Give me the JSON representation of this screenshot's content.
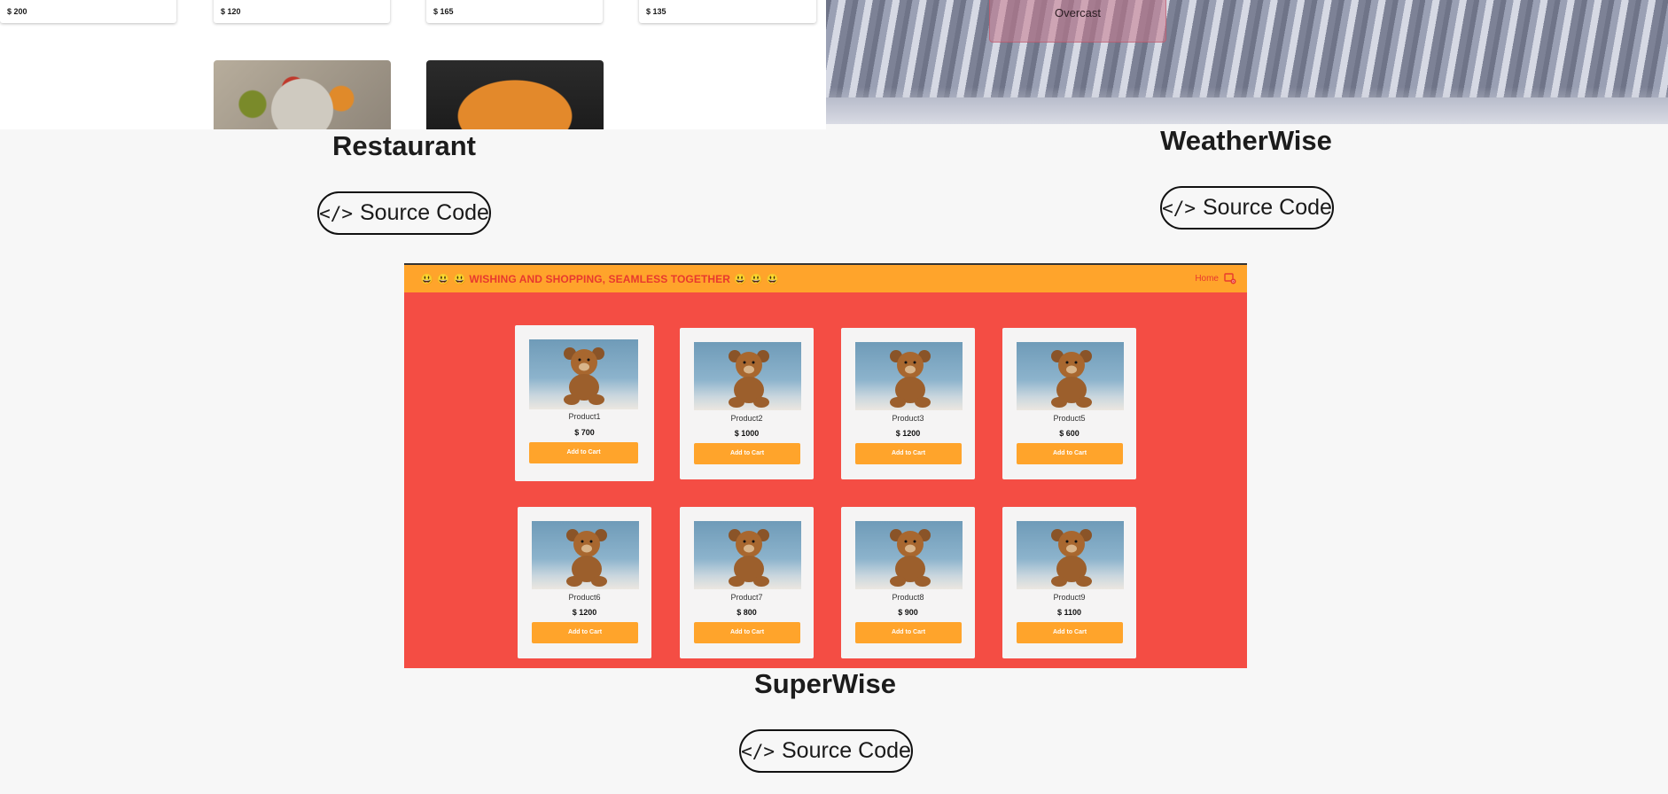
{
  "restaurant_preview": {
    "prices": [
      "$ 200",
      "$ 120",
      "$ 165",
      "$ 135"
    ]
  },
  "weather_preview": {
    "condition": "Overcast"
  },
  "projects": {
    "restaurant": {
      "title": "Restaurant",
      "button": "Source Code"
    },
    "weatherwise": {
      "title": "WeatherWise",
      "button": "Source Code"
    },
    "superwise": {
      "title": "SuperWise",
      "button": "Source Code"
    }
  },
  "superwise_preview": {
    "tagline": "😃 😃 😃 WISHING AND SHOPPING, SEAMLESS TOGETHER 😃 😃 😃",
    "nav_home": "Home",
    "cart_count": "0",
    "add_to_cart_label": "Add to Cart",
    "products": [
      {
        "name": "Product1",
        "price": "$ 700"
      },
      {
        "name": "Product2",
        "price": "$ 1000"
      },
      {
        "name": "Product3",
        "price": "$ 1200"
      },
      {
        "name": "Product5",
        "price": "$ 600"
      },
      {
        "name": "Product6",
        "price": "$ 1200"
      },
      {
        "name": "Product7",
        "price": "$ 800"
      },
      {
        "name": "Product8",
        "price": "$ 900"
      },
      {
        "name": "Product9",
        "price": "$ 1100"
      }
    ]
  },
  "colors": {
    "page_bg": "#f7f7f7",
    "superwise_bg": "#f44d44",
    "superwise_accent": "#ffa42b"
  }
}
